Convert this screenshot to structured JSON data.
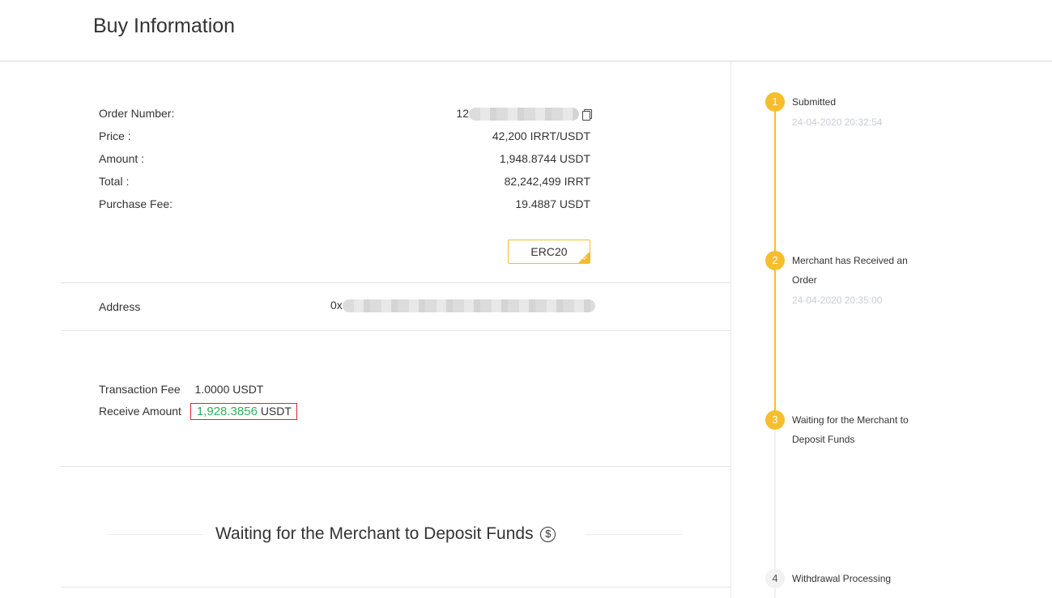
{
  "header": {
    "title": "Buy Information"
  },
  "order": {
    "order_number_label": "Order Number:",
    "order_number_prefix": "12",
    "price_label": "Price :",
    "price_value": "42,200 IRRT/USDT",
    "amount_label": "Amount :",
    "amount_value": "1,948.8744 USDT",
    "total_label": "Total :",
    "total_value": "82,242,499 IRRT",
    "fee_label": "Purchase Fee:",
    "fee_value": "19.4887 USDT"
  },
  "network": {
    "selected": "ERC20"
  },
  "address": {
    "label": "Address",
    "prefix": "0x"
  },
  "fees": {
    "transaction_fee_label": "Transaction Fee",
    "transaction_fee_value": "1.0000 USDT",
    "receive_label": "Receive Amount",
    "receive_amount": "1,928.3856",
    "receive_unit": "USDT"
  },
  "status": {
    "title": "Waiting for the Merchant to Deposit Funds",
    "icon": "dollar-circle-icon"
  },
  "steps": [
    {
      "num": "1",
      "label": "Submitted",
      "time": "24-04-2020 20:32:54",
      "state": "done"
    },
    {
      "num": "2",
      "label": "Merchant has Received an Order",
      "time": "24-04-2020 20:35:00",
      "state": "done"
    },
    {
      "num": "3",
      "label": "Waiting for the Merchant to Deposit Funds",
      "time": "",
      "state": "current"
    },
    {
      "num": "4",
      "label": "Withdrawal Processing",
      "time": "",
      "state": "pending"
    }
  ],
  "colors": {
    "accent": "#f6be2c",
    "success": "#29b35a",
    "highlight_border": "#e0262e"
  }
}
